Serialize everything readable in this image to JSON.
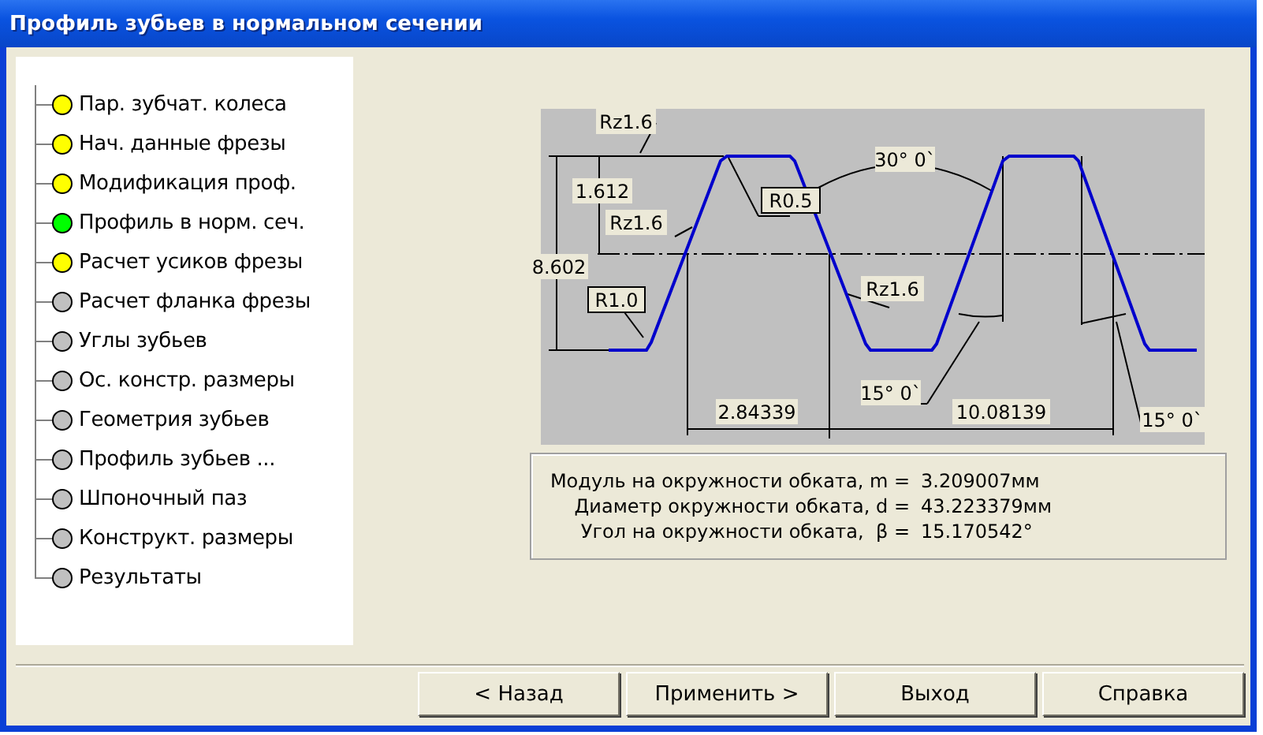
{
  "window": {
    "title": "Профиль зубьев в нормальном сечении"
  },
  "tree": {
    "items": [
      {
        "label": "Пар. зубчат. колеса",
        "color": "#ffff00"
      },
      {
        "label": "Нач. данные фрезы",
        "color": "#ffff00"
      },
      {
        "label": "Модификация проф.",
        "color": "#ffff00"
      },
      {
        "label": "Профиль в норм. сеч.",
        "color": "#00ff00"
      },
      {
        "label": "Расчет усиков фрезы",
        "color": "#ffff00"
      },
      {
        "label": "Расчет фланка фрезы",
        "color": "#c0c0c0"
      },
      {
        "label": "Углы зубьев",
        "color": "#c0c0c0"
      },
      {
        "label": "Ос. констр. размеры",
        "color": "#c0c0c0"
      },
      {
        "label": "Геометрия зубьев",
        "color": "#c0c0c0"
      },
      {
        "label": "Профиль зубьев ...",
        "color": "#c0c0c0"
      },
      {
        "label": "Шпоночный паз",
        "color": "#c0c0c0"
      },
      {
        "label": "Конструкт. размеры",
        "color": "#c0c0c0"
      },
      {
        "label": "Результаты",
        "color": "#c0c0c0"
      }
    ]
  },
  "drawing": {
    "labels": [
      {
        "text": "Rz1.6",
        "kind": "plain"
      },
      {
        "text": "1.612",
        "kind": "plain"
      },
      {
        "text": "Rz1.6",
        "kind": "plain"
      },
      {
        "text": "8.602",
        "kind": "plain"
      },
      {
        "text": "R1.0",
        "kind": "boxed"
      },
      {
        "text": "R0.5",
        "kind": "boxed"
      },
      {
        "text": "30° 0`",
        "kind": "plain"
      },
      {
        "text": "Rz1.6",
        "kind": "plain"
      },
      {
        "text": "15° 0`",
        "kind": "plain"
      },
      {
        "text": "2.84339",
        "kind": "plain"
      },
      {
        "text": "10.08139",
        "kind": "plain"
      },
      {
        "text": "15° 0`",
        "kind": "plain"
      }
    ]
  },
  "results": [
    {
      "label": "Модуль на окружности обката, m =",
      "value": "3.209007мм"
    },
    {
      "label": "Диаметр окружности обката, d =",
      "value": "43.223379мм"
    },
    {
      "label": "Угол на окружности обката,  β =",
      "value": "15.170542°"
    }
  ],
  "buttons": [
    "< Назад",
    "Применить >",
    "Выход",
    "Справка"
  ]
}
